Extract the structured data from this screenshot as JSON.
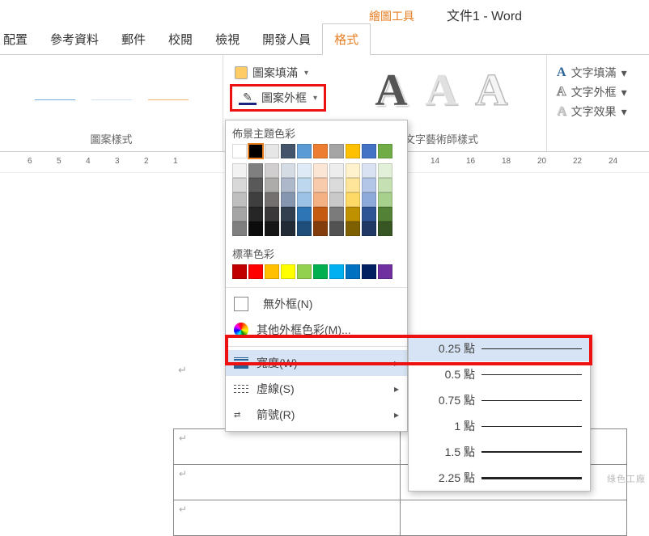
{
  "title_context": "繪圖工具",
  "doc_title": "文件1 - Word",
  "tabs": [
    "配置",
    "參考資料",
    "郵件",
    "校閱",
    "檢視",
    "開發人員",
    "格式"
  ],
  "active_tab_index": 6,
  "groups": {
    "shape_styles_label": "圖案樣式",
    "wordart_label": "文字藝術師樣式"
  },
  "shape": {
    "fill": "圖案填滿",
    "outline": "圖案外框"
  },
  "text_effects": {
    "fill": "文字填滿",
    "outline": "文字外框",
    "effects": "文字效果"
  },
  "ruler_ticks_left": [
    "6",
    "5",
    "4",
    "3",
    "2",
    "1"
  ],
  "ruler_ticks_right": [
    "14",
    "16",
    "18",
    "20",
    "22",
    "24"
  ],
  "dropdown": {
    "theme_title": "佈景主題色彩",
    "standard_title": "標準色彩",
    "no_outline": "無外框(N)",
    "more_colors": "其他外框色彩(M)...",
    "width": "寬度(W)",
    "dashes": "虛線(S)",
    "arrows": "箭號(R)"
  },
  "theme_colors_row1": [
    "#ffffff",
    "#000000",
    "#e7e6e6",
    "#44546a",
    "#5b9bd5",
    "#ed7d31",
    "#a5a5a5",
    "#ffc000",
    "#4472c4",
    "#70ad47"
  ],
  "theme_shades": [
    [
      "#f2f2f2",
      "#7f7f7f",
      "#d0cece",
      "#d6dce4",
      "#deebf6",
      "#fbe5d5",
      "#ededed",
      "#fff2cc",
      "#d9e2f3",
      "#e2efd9"
    ],
    [
      "#d8d8d8",
      "#595959",
      "#aeabab",
      "#adb9ca",
      "#bdd7ee",
      "#f7cbac",
      "#dbdbdb",
      "#fee599",
      "#b4c6e7",
      "#c5e0b3"
    ],
    [
      "#bfbfbf",
      "#3f3f3f",
      "#757070",
      "#8496b0",
      "#9cc3e5",
      "#f4b183",
      "#c9c9c9",
      "#ffd965",
      "#8eaadb",
      "#a8d08d"
    ],
    [
      "#a5a5a5",
      "#262626",
      "#3a3838",
      "#323f4f",
      "#2e75b5",
      "#c55a11",
      "#7b7b7b",
      "#bf9000",
      "#2f5496",
      "#538135"
    ],
    [
      "#7f7f7f",
      "#0c0c0c",
      "#171616",
      "#222a35",
      "#1e4e79",
      "#833c0b",
      "#525252",
      "#7f6000",
      "#1f3864",
      "#375623"
    ]
  ],
  "standard_colors": [
    "#c00000",
    "#ff0000",
    "#ffc000",
    "#ffff00",
    "#92d050",
    "#00b050",
    "#00b0f0",
    "#0070c0",
    "#002060",
    "#7030a0"
  ],
  "widths": [
    {
      "label": "0.25 點",
      "px": 0.5
    },
    {
      "label": "0.5 點",
      "px": 1
    },
    {
      "label": "0.75 點",
      "px": 1.25
    },
    {
      "label": "1 點",
      "px": 1.75
    },
    {
      "label": "1.5 點",
      "px": 2.25
    },
    {
      "label": "2.25 點",
      "px": 3
    }
  ],
  "watermark": "綠色工廠"
}
